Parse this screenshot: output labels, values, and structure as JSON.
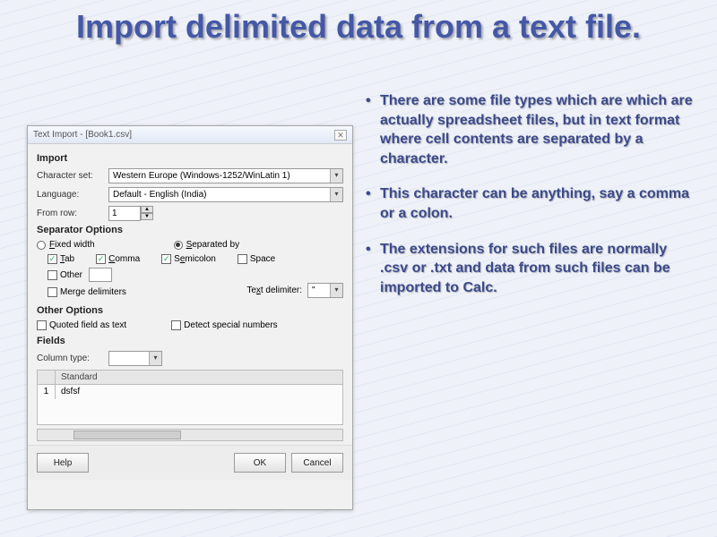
{
  "slide": {
    "title": "Import delimited data from a text file.",
    "bullets": [
      "There are some file types which are which are actually spreadsheet files, but in text format where cell contents are separated by a character.",
      "This character can be anything, say a comma or a colon.",
      "The extensions for such files are normally .csv or .txt and data from such files can be imported to Calc."
    ]
  },
  "dialog": {
    "title": "Text Import - [Book1.csv]",
    "import": {
      "heading": "Import",
      "charset_label": "Character set:",
      "charset_value": "Western Europe (Windows-1252/WinLatin 1)",
      "language_label": "Language:",
      "language_value": "Default - English (India)",
      "fromrow_label": "From row:",
      "fromrow_value": "1"
    },
    "sep": {
      "heading": "Separator Options",
      "fixed": "Fixed width",
      "separated": "Separated by",
      "tab": "Tab",
      "comma": "Comma",
      "semicolon": "Semicolon",
      "space": "Space",
      "other": "Other",
      "merge": "Merge delimiters",
      "textdelim_label": "Text delimiter:",
      "textdelim_value": "\""
    },
    "other": {
      "heading": "Other Options",
      "quoted": "Quoted field as text",
      "detect": "Detect special numbers"
    },
    "fields": {
      "heading": "Fields",
      "coltype_label": "Column type:",
      "col_header": "Standard",
      "row1_num": "1",
      "row1_data": "dsfsf"
    },
    "buttons": {
      "help": "Help",
      "ok": "OK",
      "cancel": "Cancel"
    }
  }
}
